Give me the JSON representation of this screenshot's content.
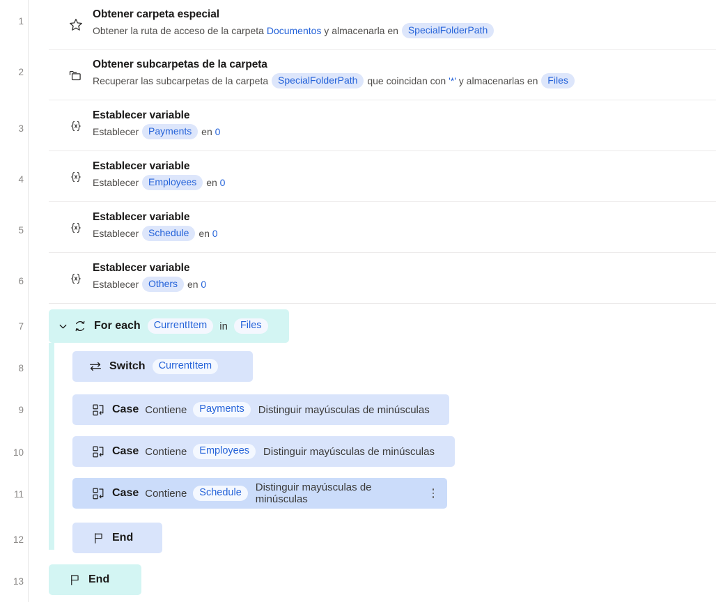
{
  "theme": {
    "page_bg": "#ffffff",
    "row_bg": "#ffffff",
    "separator": "#eceaea",
    "chip_bg": "#dde6fb",
    "chip_text": "#2563d9",
    "loop_block": "#d3f5f3",
    "switch_block": "#d9e4fb",
    "case_block": "#d9e4fb",
    "case_selected": "#cbdcfa",
    "gutter_text": "#8a8886"
  },
  "gutter": {
    "line_numbers": [
      "1",
      "2",
      "3",
      "4",
      "5",
      "6",
      "7",
      "8",
      "9",
      "10",
      "11",
      "12",
      "13"
    ]
  },
  "words": {
    "en": "en",
    "in": "in",
    "y": "y",
    "contiene": "Contiene",
    "establecer": "Establecer",
    "case_sensitive": "Distinguir mayúsculas de minúsculas"
  },
  "steps": [
    {
      "index": "1",
      "icon": "star-icon",
      "title": "Obtener carpeta especial",
      "desc_prefix": "Obtener la ruta de acceso de la carpeta ",
      "folder_link": "Documentos",
      "desc_mid": " y almacenarla en ",
      "variable": "SpecialFolderPath"
    },
    {
      "index": "2",
      "icon": "folders-icon",
      "title": "Obtener subcarpetas de la carpeta",
      "desc_prefix": "Recuperar las subcarpetas de la carpeta ",
      "source_variable": "SpecialFolderPath",
      "desc_mid": " que coincidan con ",
      "pattern": "'*'",
      "desc_suffix": " y almacenarlas en ",
      "variable": "Files"
    },
    {
      "index": "3",
      "icon": "variable-icon",
      "title": "Establecer variable",
      "desc_prefix": "Establecer ",
      "variable": "Payments",
      "desc_mid": " en ",
      "value": "0"
    },
    {
      "index": "4",
      "icon": "variable-icon",
      "title": "Establecer variable",
      "desc_prefix": "Establecer ",
      "variable": "Employees",
      "desc_mid": " en ",
      "value": "0"
    },
    {
      "index": "5",
      "icon": "variable-icon",
      "title": "Establecer variable",
      "desc_prefix": "Establecer ",
      "variable": "Schedule",
      "desc_mid": " en ",
      "value": "0"
    },
    {
      "index": "6",
      "icon": "variable-icon",
      "title": "Establecer variable",
      "desc_prefix": "Establecer ",
      "variable": "Others",
      "desc_mid": " en ",
      "value": "0"
    }
  ],
  "loop": {
    "index": "7",
    "icon": "loop-icon",
    "caret": "chevron-down-icon",
    "expanded": true,
    "keyword": "For each",
    "iterator_variable": "CurrentItem",
    "in_word": "in",
    "collection_variable": "Files"
  },
  "switch": {
    "index": "8",
    "icon": "switch-icon",
    "keyword": "Switch",
    "variable": "CurrentItem"
  },
  "cases": [
    {
      "index": "9",
      "icon": "case-icon",
      "keyword": "Case",
      "operator": "Contiene",
      "variable": "Payments",
      "option": "Distinguir mayúsculas de minúsculas",
      "selected": false,
      "has_menu": false
    },
    {
      "index": "10",
      "icon": "case-icon",
      "keyword": "Case",
      "operator": "Contiene",
      "variable": "Employees",
      "option": "Distinguir mayúsculas de minúsculas",
      "selected": false,
      "has_menu": false
    },
    {
      "index": "11",
      "icon": "case-icon",
      "keyword": "Case",
      "operator": "Contiene",
      "variable": "Schedule",
      "option": "Distinguir mayúsculas de minúsculas",
      "selected": true,
      "has_menu": true,
      "menu_icon": "more-options-icon"
    }
  ],
  "switch_end": {
    "index": "12",
    "icon": "flag-icon",
    "keyword": "End"
  },
  "loop_end": {
    "index": "13",
    "icon": "flag-icon",
    "keyword": "End"
  }
}
